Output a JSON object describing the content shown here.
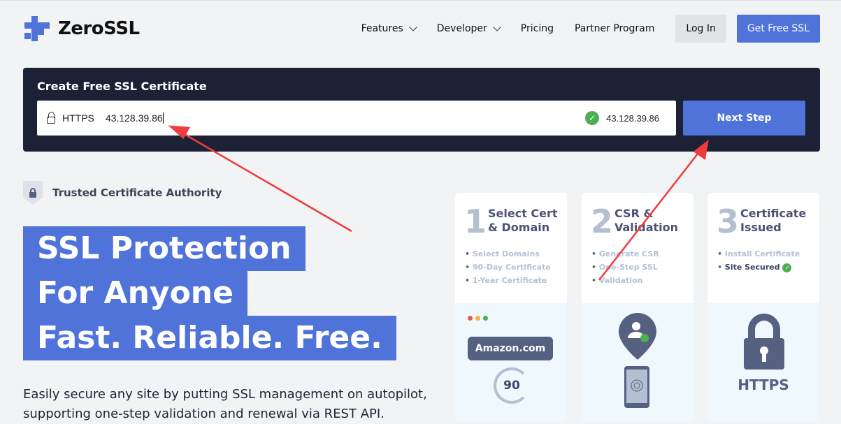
{
  "brand": {
    "name": "ZeroSSL",
    "accent": "#4f73d9"
  },
  "nav": {
    "items": [
      {
        "label": "Features",
        "dropdown": true
      },
      {
        "label": "Developer",
        "dropdown": true
      },
      {
        "label": "Pricing"
      },
      {
        "label": "Partner Program"
      }
    ],
    "login": "Log In",
    "cta": "Get Free SSL"
  },
  "create": {
    "title": "Create Free SSL Certificate",
    "protocol": "HTTPS",
    "value": "43.128.39.86",
    "verified": "43.128.39.86",
    "next": "Next Step"
  },
  "trust": "Trusted Certificate Authority",
  "hero": {
    "lines": [
      "SSL Protection",
      "For Anyone",
      "Fast. Reliable. Free."
    ],
    "desc1": "Easily secure any site by putting SSL management on autopilot,",
    "desc2": "supporting one-step validation and renewal via REST API."
  },
  "steps": [
    {
      "num": "1",
      "t1": "Select Cert",
      "t2": "& Domain",
      "items": [
        "Select Domains",
        "90-Day Certificate",
        "1-Year Certificate"
      ],
      "domain": "Amazon.com",
      "days": "90"
    },
    {
      "num": "2",
      "t1": "CSR &",
      "t2": "Validation",
      "items": [
        "Generate CSR",
        "One-Step SSL",
        "Validation"
      ]
    },
    {
      "num": "3",
      "t1": "Certificate",
      "t2": "Issued",
      "items": [
        "Install Certificate",
        "Site Secured"
      ],
      "badge": "HTTPS"
    }
  ]
}
